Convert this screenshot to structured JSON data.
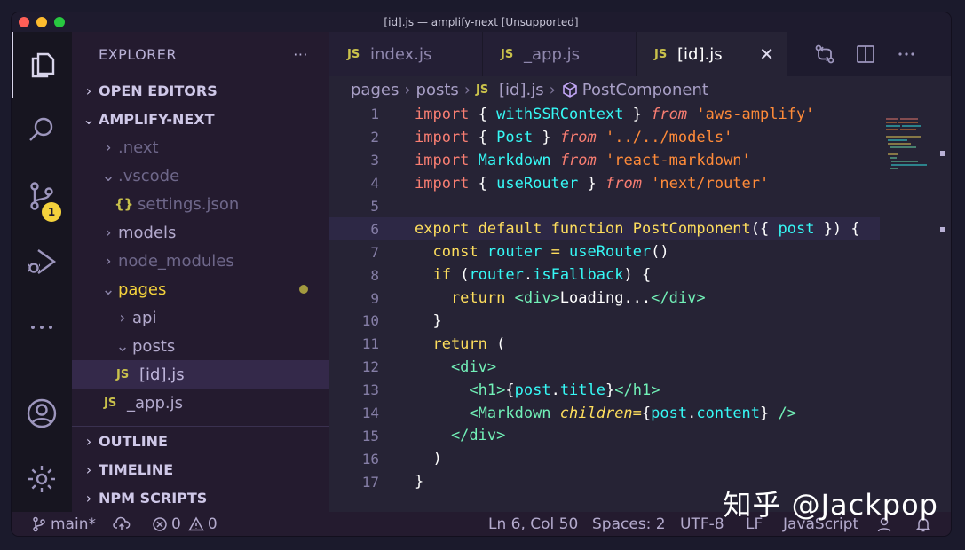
{
  "window": {
    "title": "[id].js — amplify-next [Unsupported]"
  },
  "activity": {
    "scm_badge": "1"
  },
  "sidebar": {
    "title": "EXPLORER",
    "more": "···",
    "sections": {
      "open_editors": "OPEN EDITORS",
      "project": "AMPLIFY-NEXT",
      "outline": "OUTLINE",
      "timeline": "TIMELINE",
      "npm": "NPM SCRIPTS"
    },
    "tree": [
      {
        "label": ".next",
        "kind": "folder-closed",
        "dim": true
      },
      {
        "label": ".vscode",
        "kind": "folder-open",
        "dim": true
      },
      {
        "label": "settings.json",
        "kind": "json",
        "dim": true
      },
      {
        "label": "models",
        "kind": "folder-closed",
        "dim": false
      },
      {
        "label": "node_modules",
        "kind": "folder-closed",
        "dim": true
      },
      {
        "label": "pages",
        "kind": "folder-open",
        "dim": false,
        "modified": true
      },
      {
        "label": "api",
        "kind": "folder-closed",
        "dim": false
      },
      {
        "label": "posts",
        "kind": "folder-open",
        "dim": false
      },
      {
        "label": "[id].js",
        "kind": "js",
        "selected": true
      },
      {
        "label": "_app.js",
        "kind": "js"
      }
    ]
  },
  "tabs": [
    {
      "label": "index.js",
      "icon": "JS"
    },
    {
      "label": "_app.js",
      "icon": "JS"
    },
    {
      "label": "[id].js",
      "icon": "JS",
      "active": true
    }
  ],
  "breadcrumb": {
    "p1": "pages",
    "p2": "posts",
    "p3": "[id].js",
    "p4": "PostComponent"
  },
  "code": {
    "l1": {
      "a": "import",
      "b": " { ",
      "c": "withSSRContext",
      "d": " } ",
      "e": "from",
      "f": " ",
      "g": "'aws-amplify'"
    },
    "l2": {
      "a": "import",
      "b": " { ",
      "c": "Post",
      "d": " } ",
      "e": "from",
      "f": " ",
      "g": "'../../models'"
    },
    "l3": {
      "a": "import",
      "b": " ",
      "c": "Markdown",
      "d": " ",
      "e": "from",
      "f": " ",
      "g": "'react-markdown'"
    },
    "l4": {
      "a": "import",
      "b": " { ",
      "c": "useRouter",
      "d": " } ",
      "e": "from",
      "f": " ",
      "g": "'next/router'"
    },
    "l6": {
      "a": "export",
      "b": " ",
      "c": "default",
      "d": " ",
      "e": "function",
      "f": " ",
      "g": "PostComponent",
      "h": "({ ",
      "i": "post",
      "j": " }) {"
    },
    "l7": {
      "a": "  const",
      "b": " ",
      "c": "router",
      "d": " = ",
      "e": "useRouter",
      "f": "()"
    },
    "l8": {
      "a": "  if",
      "b": " (",
      "c": "router",
      "d": ".",
      "e": "isFallback",
      "f": ") {"
    },
    "l9": {
      "a": "    return",
      "b": " ",
      "c": "<div>",
      "d": "Loading...",
      "e": "</div>"
    },
    "l10": "  }",
    "l11": {
      "a": "  return",
      "b": " ("
    },
    "l12": "    <div>",
    "l13": {
      "a": "      <h1>",
      "b": "{",
      "c": "post",
      "d": ".",
      "e": "title",
      "f": "}",
      "g": "</h1>"
    },
    "l14": {
      "a": "      <Markdown",
      "b": " ",
      "c": "children",
      "d": "=",
      "e": "{",
      "f": "post",
      "g": ".",
      "h": "content",
      "i": "}",
      "j": " />"
    },
    "l15": "    </div>",
    "l16": "  )",
    "l17": "}"
  },
  "status": {
    "branch": "main*",
    "errors": "0",
    "warnings": "0",
    "cursor": "Ln 6, Col 50",
    "spaces": "Spaces: 2",
    "encoding": "UTF-8",
    "eol": "LF",
    "language": "JavaScript"
  },
  "watermark": "知乎 @Jackpop"
}
